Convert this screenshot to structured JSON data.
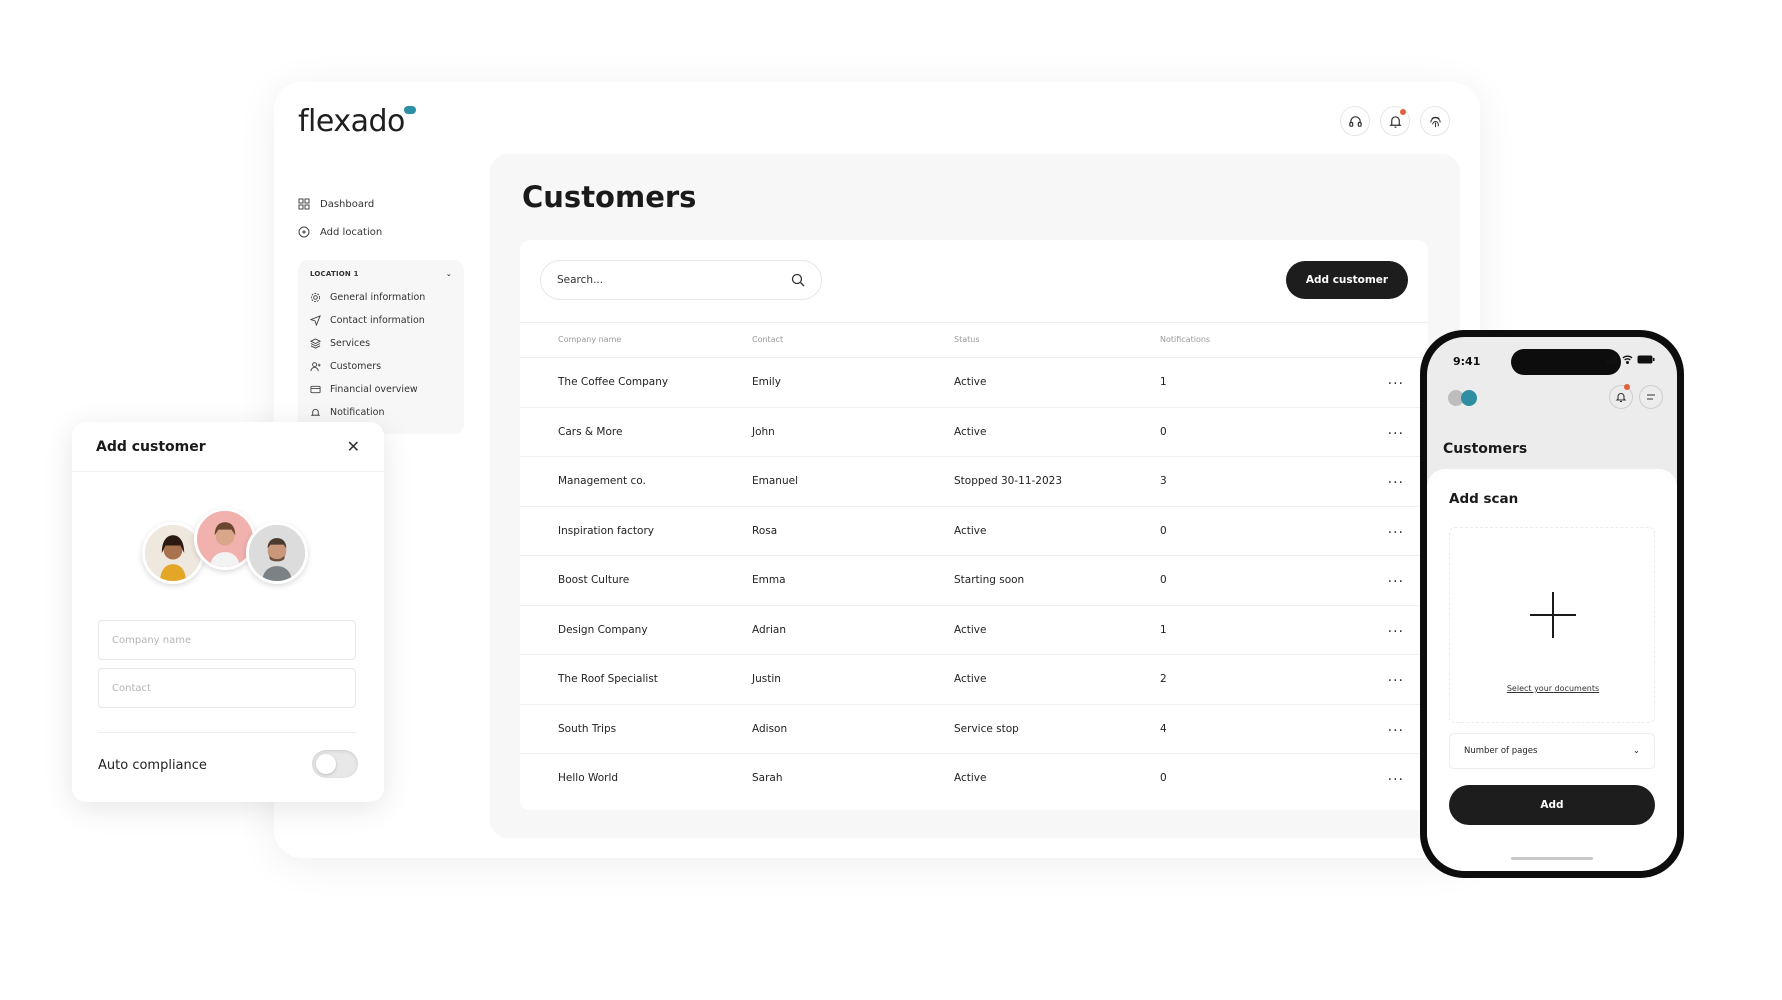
{
  "app": {
    "logo_text": "flexado"
  },
  "sidebar": {
    "items": [
      {
        "label": "Dashboard",
        "icon": "grid-icon"
      },
      {
        "label": "Add location",
        "icon": "location-plus-icon"
      }
    ],
    "location": {
      "title": "LOCATION 1",
      "items": [
        {
          "label": "General information",
          "icon": "gear-icon"
        },
        {
          "label": "Contact information",
          "icon": "send-icon"
        },
        {
          "label": "Services",
          "icon": "layers-icon"
        },
        {
          "label": "Customers",
          "icon": "user-plus-icon"
        },
        {
          "label": "Financial overview",
          "icon": "card-icon"
        },
        {
          "label": "Notification",
          "icon": "bell-icon"
        }
      ]
    }
  },
  "main": {
    "title": "Customers",
    "search_placeholder": "Search...",
    "add_button": "Add customer",
    "columns": [
      "Company name",
      "Contact",
      "Status",
      "Notifications"
    ],
    "rows": [
      {
        "company": "The Coffee Company",
        "contact": "Emily",
        "status": "Active",
        "notifications": "1"
      },
      {
        "company": "Cars & More",
        "contact": "John",
        "status": "Active",
        "notifications": "0"
      },
      {
        "company": "Management co.",
        "contact": "Emanuel",
        "status": "Stopped  30-11-2023",
        "notifications": "3"
      },
      {
        "company": "Inspiration factory",
        "contact": "Rosa",
        "status": "Active",
        "notifications": "0"
      },
      {
        "company": "Boost Culture",
        "contact": "Emma",
        "status": "Starting soon",
        "notifications": "0"
      },
      {
        "company": "Design Company",
        "contact": "Adrian",
        "status": "Active",
        "notifications": "1"
      },
      {
        "company": "The Roof Specialist",
        "contact": "Justin",
        "status": "Active",
        "notifications": "2"
      },
      {
        "company": "South Trips",
        "contact": "Adison",
        "status": "Service stop",
        "notifications": "4"
      },
      {
        "company": "Hello World",
        "contact": "Sarah",
        "status": "Active",
        "notifications": "0"
      }
    ],
    "row_menu": "..."
  },
  "modal": {
    "title": "Add customer",
    "close": "✕",
    "company_placeholder": "Company name",
    "contact_placeholder": "Contact",
    "auto_compliance_label": "Auto compliance",
    "auto_compliance_on": false
  },
  "phone": {
    "time": "9:41",
    "title": "Customers",
    "sheet_title": "Add scan",
    "select_documents": "Select your documents",
    "pages_select": "Number of pages",
    "add_button": "Add"
  },
  "colors": {
    "accent": "#2e8fa3",
    "dark": "#1d1d1d",
    "badge": "#e0613e"
  }
}
